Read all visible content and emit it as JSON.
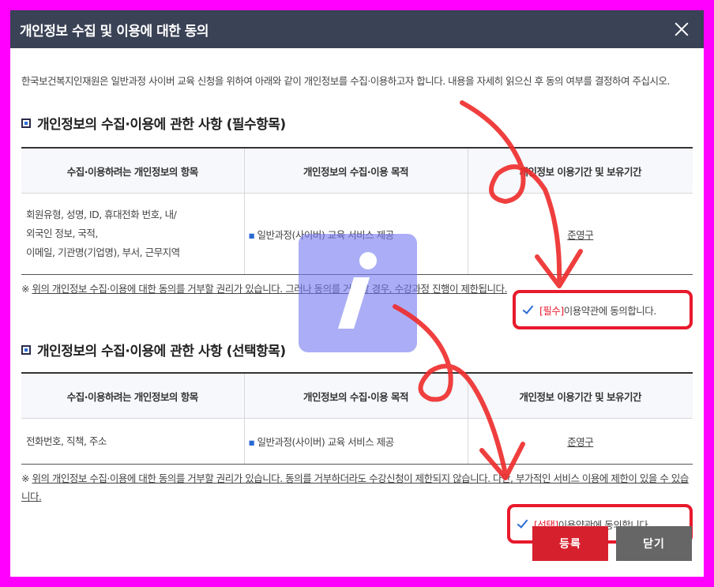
{
  "modal": {
    "title": "개인정보 수집 및 이용에 대한 동의",
    "intro": "한국보건복지인재원은 일반과정 사이버 교육 신청을 위하여 아래와 같이 개인정보를 수집·이용하고자 합니다. 내용을 자세히 읽으신 후 동의 여부를 결정하여 주십시오."
  },
  "section_required": {
    "title": "개인정보의 수집·이용에 관한 사항 (필수항목)",
    "headers": [
      "수집·이용하려는 개인정보의 항목",
      "개인정보의 수집·이용 목적",
      "개인정보 이용기간 및 보유기간"
    ],
    "items_lines": [
      "회원유형, 성명, ID, 휴대전화 번호, 내/",
      "외국인 정보, 국적,",
      "이메일, 기관명(기업명), 부서, 근무지역"
    ],
    "purpose": "일반과정(사이버) 교육 서비스 제공",
    "period": "준영구",
    "notice": "위의 개인정보 수집·이용에 대한 동의를 거부할 권리가 있습니다. 그러나 동의를 거부할 경우, 수강과정 진행이 제한됩니다.",
    "agree_tag": "[필수]",
    "agree_text": "이용약관에 동의합니다."
  },
  "section_optional": {
    "title": "개인정보의 수집·이용에 관한 사항 (선택항목)",
    "headers": [
      "수집·이용하려는 개인정보의 항목",
      "개인정보의 수집·이용 목적",
      "개인정보 이용기간 및 보유기간"
    ],
    "items": "전화번호, 직책, 주소",
    "purpose": "일반과정(사이버) 교육 서비스 제공",
    "period": "준영구",
    "notice": "위의 개인정보 수집·이용에 대한 동의를 거부할 권리가 있습니다. 동의를 거부하더라도 수강신청이 제한되지 않습니다. 다만, 부가적인 서비스 이용에 제한이 있을 수 있습니다.",
    "agree_tag": "[선택]",
    "agree_text": "이용약관에 동의합니다."
  },
  "buttons": {
    "register": "등록",
    "close": "닫기"
  },
  "colors": {
    "header_bg": "#3a4256",
    "accent_red": "#e8192c",
    "register_btn": "#d7202e",
    "close_btn": "#666666",
    "frame": "#ff00ff"
  }
}
